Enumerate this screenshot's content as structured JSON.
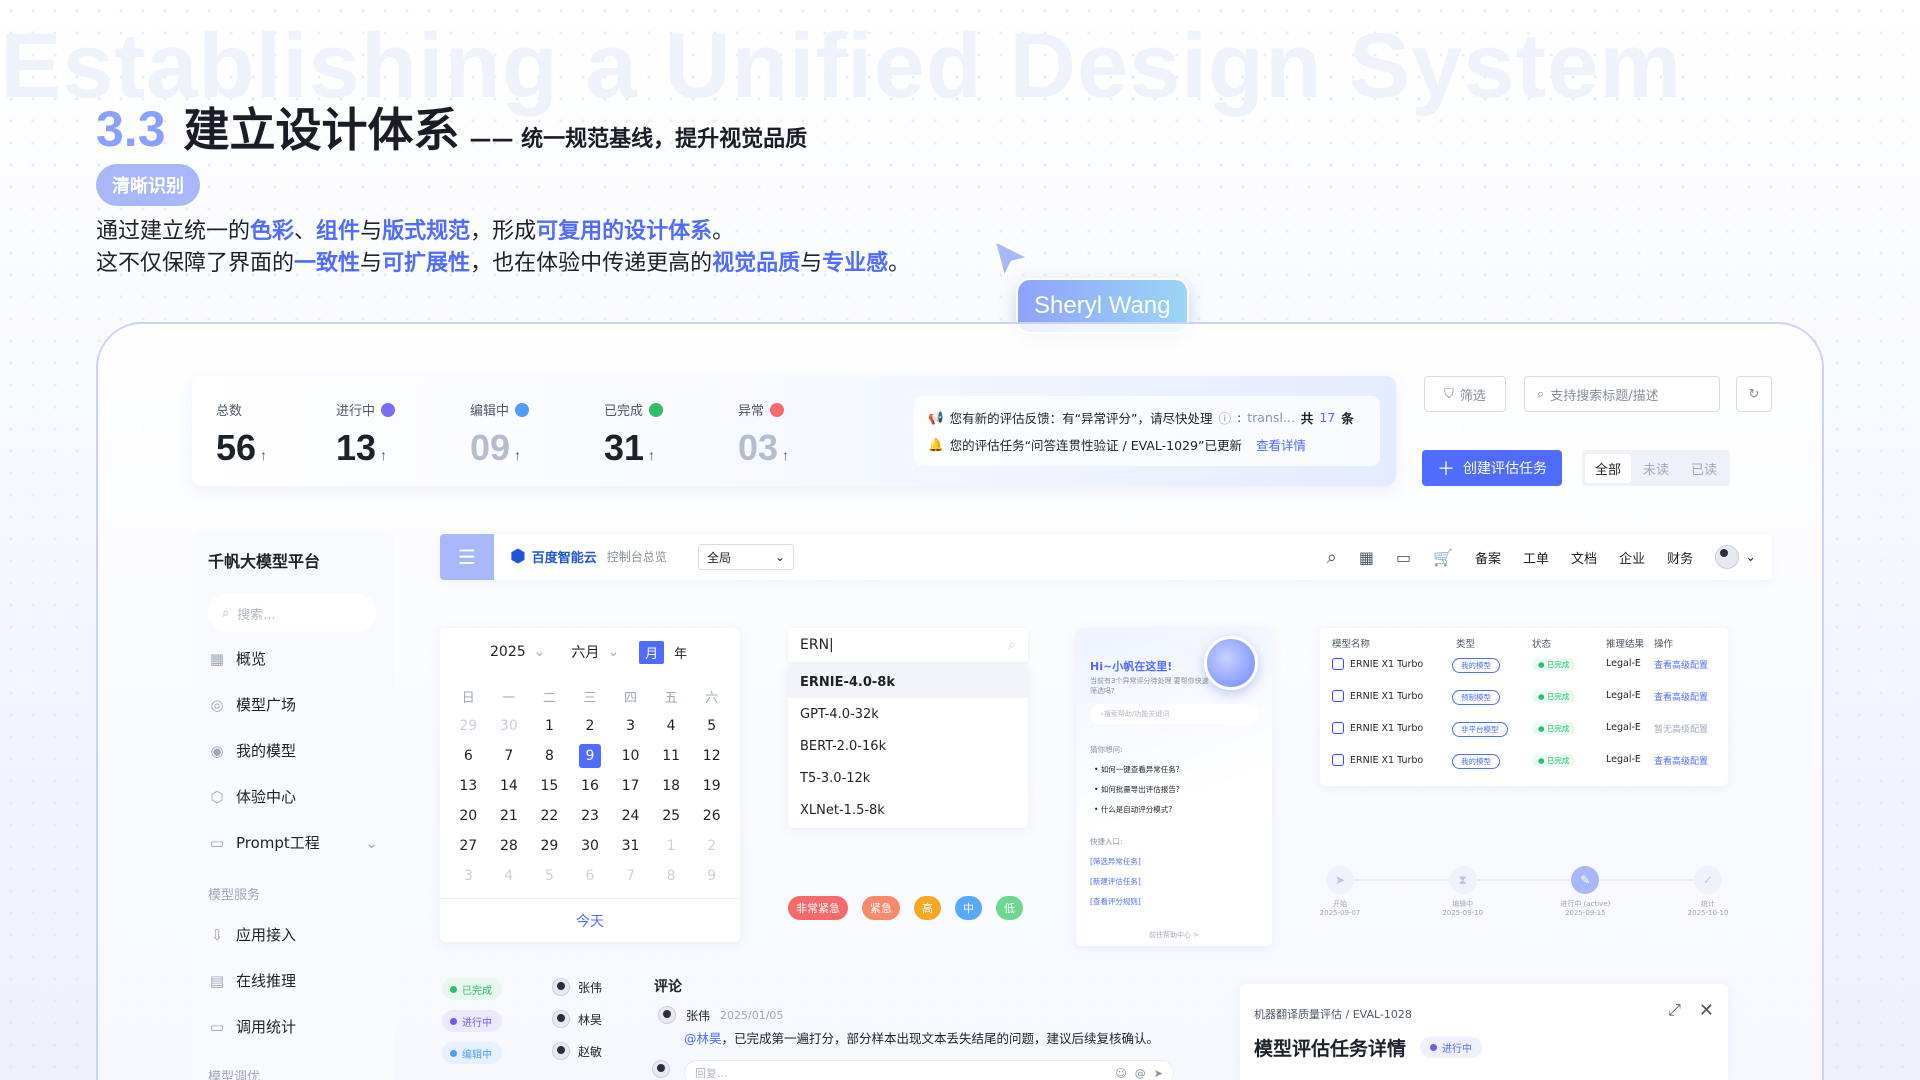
{
  "bg_title": "Establishing a Unified Design System",
  "heading": {
    "num": "3.3",
    "main": "建立设计体系",
    "sub": "—— 统一规范基线，提升视觉品质"
  },
  "chip": "清晰识别",
  "intro": {
    "line1": [
      "通过建立统一的",
      "色彩",
      "、",
      "组件",
      "与",
      "版式规范",
      "，形成",
      "可复用的设计体系",
      "。"
    ],
    "line2": [
      "这不仅保障了界面的",
      "一致性",
      "与",
      "可扩展性",
      "，也在体验中传递更高的",
      "视觉品质",
      "与",
      "专业感",
      "。"
    ]
  },
  "cursor_name": "Sheryl Wang",
  "stats": [
    {
      "label": "总数",
      "value": "56",
      "dot": ""
    },
    {
      "label": "进行中",
      "value": "13",
      "dot": "#7b6cf6"
    },
    {
      "label": "编辑中",
      "value": "09",
      "dot": "#4f9cff"
    },
    {
      "label": "已完成",
      "value": "31",
      "dot": "#2ebd6b"
    },
    {
      "label": "异常",
      "value": "03",
      "dot": "#f76a6a"
    }
  ],
  "notice": {
    "line1": "您有新的评估反馈：有“异常评分”，请尽快处理",
    "line1_link": "transl...",
    "line1_count_prefix": "共",
    "line1_count": "17",
    "line1_count_suffix": "条",
    "line2": "您的评估任务“问答连贯性验证 / EVAL-1029”已更新",
    "line2_link": "查看详情"
  },
  "toolbar": {
    "filter": "筛选",
    "search_placeholder": "支持搜索标题/描述",
    "create": "创建评估任务",
    "seg": [
      "全部",
      "未读",
      "已读"
    ]
  },
  "sidebar": {
    "title": "千帆大模型平台",
    "search": "搜索...",
    "items": [
      "概览",
      "模型广场",
      "我的模型",
      "体验中心",
      "Prompt工程"
    ],
    "group1": "模型服务",
    "items2": [
      "应用接入",
      "在线推理",
      "调用统计"
    ],
    "group2": "模型调优"
  },
  "topbar": {
    "brand": "百度智能云",
    "brand_sub": "控制台总览",
    "region": "全局",
    "links": [
      "备案",
      "工单",
      "文档",
      "企业",
      "财务"
    ]
  },
  "calendar": {
    "year": "2025",
    "month": "六月",
    "modes": [
      "月",
      "年"
    ],
    "weekdays": [
      "日",
      "一",
      "二",
      "三",
      "四",
      "五",
      "六"
    ],
    "days": [
      [
        "29",
        "30",
        "1",
        "2",
        "3",
        "4",
        "5"
      ],
      [
        "6",
        "7",
        "8",
        "9",
        "10",
        "11",
        "12"
      ],
      [
        "13",
        "14",
        "15",
        "16",
        "17",
        "18",
        "19"
      ],
      [
        "20",
        "21",
        "22",
        "23",
        "24",
        "25",
        "26"
      ],
      [
        "27",
        "28",
        "29",
        "30",
        "31",
        "1",
        "2"
      ],
      [
        "3",
        "4",
        "5",
        "6",
        "7",
        "8",
        "9"
      ]
    ],
    "today_label": "今天"
  },
  "autocomplete": {
    "value": "ERN",
    "options": [
      "ERNIE-4.0-8k",
      "GPT-4.0-32k",
      "BERT-2.0-16k",
      "T5-3.0-12k",
      "XLNet-1.5-8k"
    ]
  },
  "priority_tags": [
    {
      "label": "非常紧急",
      "color": "#f76a6a"
    },
    {
      "label": "紧急",
      "color": "#f78a6a"
    },
    {
      "label": "高",
      "color": "#f7a823"
    },
    {
      "label": "中",
      "color": "#5aa9f7"
    },
    {
      "label": "低",
      "color": "#6dd68f"
    }
  ],
  "assistant": {
    "greet": "Hi~小帆在这里!",
    "desc": "当前有3个异常评分待处理 要帮你快速筛选吗?",
    "input": "搜索帮助/功能关键词",
    "guess": "猜你想问:",
    "qs": [
      "如何一键查看异常任务?",
      "如何批量导出评估报告?",
      "什么是自动评分模式?"
    ],
    "quick": "快捷入口:",
    "links": [
      "[筛选异常任务]",
      "[新建评估任务]",
      "[查看评分规则]"
    ],
    "foot": "前往帮助中心 >"
  },
  "model_table": {
    "headers": [
      "模型名称",
      "类型",
      "状态",
      "推理结果",
      "操作"
    ],
    "rows": [
      {
        "name": "ERNIE X1 Turbo",
        "type": "我的模型",
        "status": "已完成",
        "result": "Legal-E",
        "op": "查看高级配置",
        "op_off": false
      },
      {
        "name": "ERNIE X1 Turbo",
        "type": "预制模型",
        "status": "已完成",
        "result": "Legal-E",
        "op": "查看高级配置",
        "op_off": false
      },
      {
        "name": "ERNIE X1 Turbo",
        "type": "非平台模型",
        "status": "已完成",
        "result": "Legal-E",
        "op": "暂无高级配置",
        "op_off": true
      },
      {
        "name": "ERNIE X1 Turbo",
        "type": "我的模型",
        "status": "已完成",
        "result": "Legal-E",
        "op": "查看高级配置",
        "op_off": false
      }
    ]
  },
  "steps": [
    {
      "label": "开始",
      "date": "2025-09-07",
      "icon": "send-icon"
    },
    {
      "label": "编辑中",
      "date": "2025-09-10",
      "icon": "hourglass-icon"
    },
    {
      "label": "进行中 (active)",
      "date": "2025-09-15",
      "icon": "edit-icon"
    },
    {
      "label": "统计",
      "date": "2025-10-10",
      "icon": "check-icon"
    }
  ],
  "status_pills": [
    {
      "label": "已完成",
      "bg": "#e6f7ee",
      "dot": "#2ebd6b",
      "color": "#2ebd6b"
    },
    {
      "label": "进行中",
      "bg": "#ece9ff",
      "dot": "#6b5cf6",
      "color": "#6b5cf6"
    },
    {
      "label": "编辑中",
      "bg": "#e6f1ff",
      "dot": "#4f9cff",
      "color": "#4f9cff"
    }
  ],
  "people": [
    "张伟",
    "林昊",
    "赵敏"
  ],
  "comment": {
    "title": "评论",
    "author": "张伟",
    "time": "2025/01/05",
    "mention": "@林昊",
    "text": "，已完成第一遍打分，部分样本出现文本丢失结尾的问题，建议后续复核确认。",
    "reply_placeholder": "回复..."
  },
  "detail": {
    "crumb": "机器翻译质量评估 / EVAL-1028",
    "title": "模型评估任务详情",
    "badge": "进行中"
  }
}
